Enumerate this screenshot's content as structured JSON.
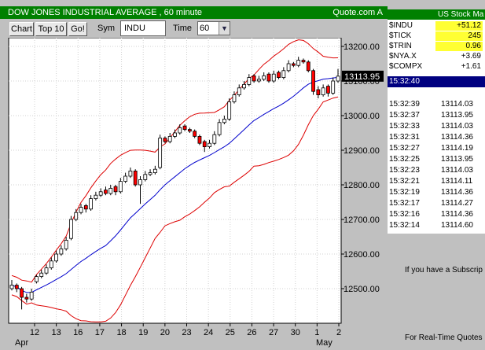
{
  "chart_window": {
    "title": "DOW JONES INDUSTRIAL AVERAGE , 60 minute",
    "source": "Quote.com  A"
  },
  "toolbar": {
    "chart_label": "Chart",
    "top10_label": "Top 10",
    "go_label": "Go!",
    "symbol_label": "Sym",
    "symbol_value": "INDU",
    "time_label": "Time",
    "interval_value": "60"
  },
  "chart_data": {
    "type": "candlestick",
    "x_tick_labels": [
      "12",
      "13",
      "16",
      "17",
      "18",
      "19",
      "20",
      "23",
      "24",
      "25",
      "26",
      "27",
      "30",
      "1",
      "2"
    ],
    "x_period_labels": [
      "Apr",
      "May"
    ],
    "y_tick_labels": [
      "13200.00",
      "13100.00",
      "13000.00",
      "12900.00",
      "12800.00",
      "12700.00",
      "12600.00",
      "12500.00"
    ],
    "y_ticks": [
      13200,
      13100,
      13000,
      12900,
      12800,
      12700,
      12600,
      12500
    ],
    "ylim": [
      12400,
      13225
    ],
    "last_price_label": "13113.95",
    "last_price": 13113.95,
    "colors": {
      "up": "#000000",
      "down": "#ff0000",
      "band": "#dd0000",
      "average": "#0000cc",
      "price_tag": "#000000"
    },
    "closes": [
      12510,
      12500,
      12475,
      12470,
      12490,
      12535,
      12545,
      12560,
      12580,
      12600,
      12615,
      12640,
      12700,
      12720,
      12735,
      12730,
      12760,
      12770,
      12780,
      12775,
      12790,
      12780,
      12810,
      12825,
      12840,
      12800,
      12815,
      12830,
      12835,
      12845,
      12935,
      12925,
      12940,
      12950,
      12965,
      12960,
      12955,
      12940,
      12920,
      12910,
      12920,
      12945,
      12980,
      12990,
      13040,
      13060,
      13080,
      13090,
      13110,
      13100,
      13105,
      13115,
      13100,
      13120,
      13110,
      13130,
      13150,
      13145,
      13160,
      13155,
      13130,
      13070,
      13060,
      13080,
      13065,
      13100,
      13114
    ],
    "opens": [
      12500,
      12510,
      12500,
      12475,
      12470,
      12520,
      12535,
      12545,
      12560,
      12580,
      12600,
      12615,
      12645,
      12700,
      12720,
      12740,
      12730,
      12760,
      12770,
      12785,
      12775,
      12795,
      12780,
      12810,
      12825,
      12840,
      12800,
      12815,
      12830,
      12835,
      12850,
      12935,
      12925,
      12940,
      12950,
      12970,
      12960,
      12955,
      12940,
      12925,
      12910,
      12920,
      12945,
      12980,
      12990,
      13040,
      13060,
      13080,
      13090,
      13115,
      13100,
      13105,
      13120,
      13100,
      13125,
      13110,
      13130,
      13150,
      13145,
      13160,
      13155,
      13130,
      13075,
      13060,
      13085,
      13065,
      13100
    ],
    "highs": [
      12525,
      12515,
      12505,
      12485,
      12500,
      12540,
      12555,
      12570,
      12590,
      12610,
      12625,
      12650,
      12710,
      12730,
      12745,
      12745,
      12770,
      12780,
      12790,
      12795,
      12800,
      12800,
      12820,
      12835,
      12850,
      12845,
      12825,
      12840,
      12845,
      12855,
      12945,
      12940,
      12950,
      12960,
      12975,
      12975,
      12965,
      12960,
      12945,
      12930,
      12930,
      12955,
      12990,
      13000,
      13050,
      13070,
      13090,
      13100,
      13120,
      13120,
      13115,
      13125,
      13125,
      13130,
      13130,
      13140,
      13160,
      13155,
      13170,
      13165,
      13160,
      13135,
      13085,
      13090,
      13090,
      13110,
      13135
    ],
    "lows": [
      12495,
      12490,
      12440,
      12460,
      12465,
      12515,
      12530,
      12540,
      12555,
      12575,
      12595,
      12610,
      12640,
      12695,
      12715,
      12720,
      12725,
      12755,
      12765,
      12770,
      12770,
      12770,
      12775,
      12805,
      12820,
      12795,
      12745,
      12810,
      12825,
      12830,
      12845,
      12920,
      12920,
      12935,
      12945,
      12955,
      12950,
      12935,
      12915,
      12895,
      12905,
      12915,
      12940,
      12975,
      12985,
      13035,
      13055,
      13075,
      13085,
      13095,
      13095,
      13100,
      13095,
      13095,
      13105,
      13105,
      13125,
      13140,
      13140,
      13150,
      13125,
      13060,
      13050,
      13055,
      13055,
      13060,
      13095
    ],
    "moving_average_period": 20,
    "band_width_multiplier": 2
  },
  "quote_window": {
    "title": "US Stock Ma",
    "quotes": [
      {
        "symbol": "$INDU",
        "change": "+51.12",
        "highlight": true
      },
      {
        "symbol": "$TICK",
        "change": "245",
        "highlight": true
      },
      {
        "symbol": "$TRIN",
        "change": "0.96",
        "highlight": true
      },
      {
        "symbol": "$NYA.X",
        "change": "+3.69",
        "highlight": false
      },
      {
        "symbol": "$COMPX",
        "change": "+1.61",
        "highlight": false
      }
    ],
    "clock": "15:32:40",
    "ticks": [
      {
        "time": "15:32:39",
        "price": "13114.03"
      },
      {
        "time": "15:32:37",
        "price": "13113.95"
      },
      {
        "time": "15:32:33",
        "price": "13114.03"
      },
      {
        "time": "15:32:31",
        "price": "13114.36"
      },
      {
        "time": "15:32:27",
        "price": "13114.19"
      },
      {
        "time": "15:32:25",
        "price": "13113.95"
      },
      {
        "time": "15:32:23",
        "price": "13114.03"
      },
      {
        "time": "15:32:21",
        "price": "13114.11"
      },
      {
        "time": "15:32:19",
        "price": "13114.36"
      },
      {
        "time": "15:32:17",
        "price": "13114.27"
      },
      {
        "time": "15:32:16",
        "price": "13114.36"
      },
      {
        "time": "15:32:14",
        "price": "13114.60"
      }
    ],
    "ad_line1": "If you have a Subscrip",
    "ad_line2": "For Real-Time Quotes"
  }
}
